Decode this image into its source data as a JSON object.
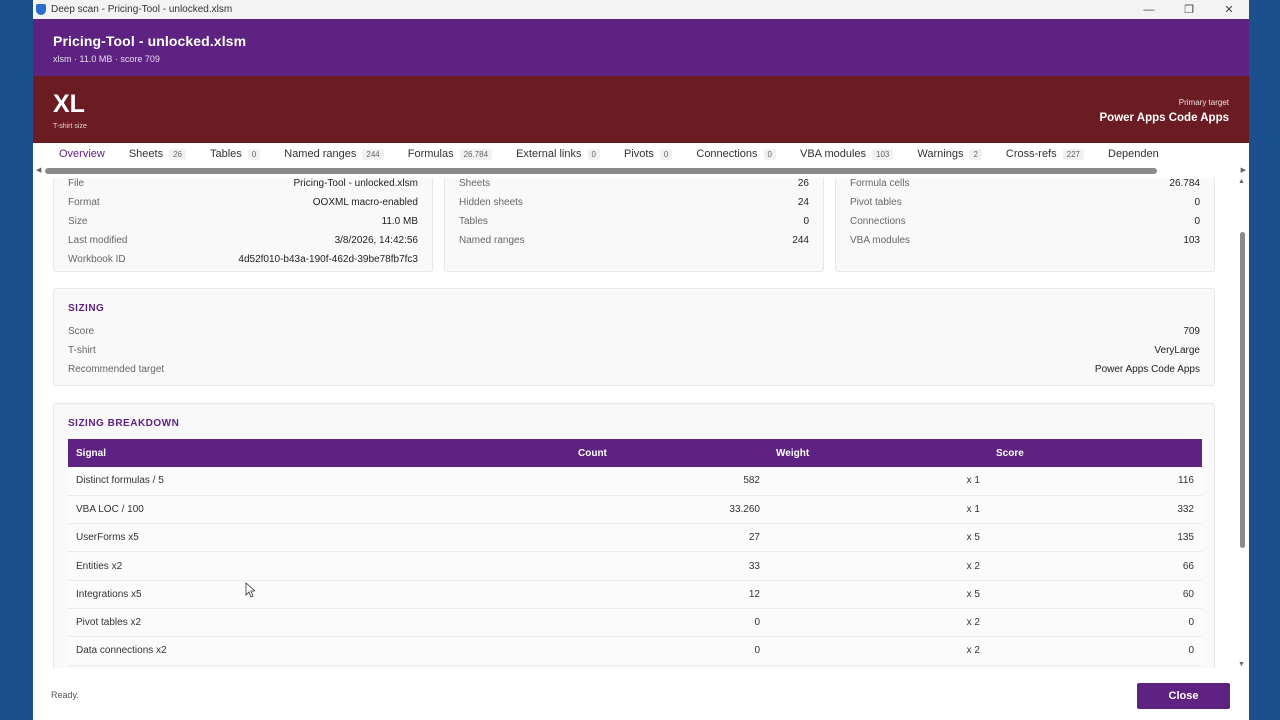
{
  "window": {
    "title": "Deep scan - Pricing-Tool - unlocked.xlsm",
    "controls": [
      "—",
      "❐",
      "✕"
    ]
  },
  "header": {
    "file_title": "Pricing-Tool - unlocked.xlsm",
    "file_meta": "xlsm · 11.0 MB · score 709",
    "size_code": "XL",
    "size_caption": "T-shirt size",
    "primary_target_label": "Primary target",
    "primary_target_value": "Power Apps Code Apps",
    "accent_purple": "#5e2282",
    "accent_red": "#6b1c22"
  },
  "tabs": [
    {
      "label": "Overview",
      "count": ""
    },
    {
      "label": "Sheets",
      "count": "26"
    },
    {
      "label": "Tables",
      "count": "0"
    },
    {
      "label": "Named ranges",
      "count": "244"
    },
    {
      "label": "Formulas",
      "count": "26.784"
    },
    {
      "label": "External links",
      "count": "0"
    },
    {
      "label": "Pivots",
      "count": "0"
    },
    {
      "label": "Connections",
      "count": "0"
    },
    {
      "label": "VBA modules",
      "count": "103"
    },
    {
      "label": "Warnings",
      "count": "2"
    },
    {
      "label": "Cross-refs",
      "count": "227"
    },
    {
      "label": "Dependen",
      "count": ""
    }
  ],
  "overview": {
    "file_card": [
      {
        "k": "File",
        "v": "Pricing-Tool - unlocked.xlsm"
      },
      {
        "k": "Format",
        "v": "OOXML macro-enabled"
      },
      {
        "k": "Size",
        "v": "11.0 MB"
      },
      {
        "k": "Last modified",
        "v": "3/8/2026, 14:42:56"
      },
      {
        "k": "Workbook ID",
        "v": "4d52f010-b43a-190f-462d-39be78fb7fc3"
      }
    ],
    "sheets_card": [
      {
        "k": "Sheets",
        "v": "26"
      },
      {
        "k": "Hidden sheets",
        "v": "24"
      },
      {
        "k": "Tables",
        "v": "0"
      },
      {
        "k": "Named ranges",
        "v": "244"
      }
    ],
    "formula_card": [
      {
        "k": "Formula cells",
        "v": "26.784"
      },
      {
        "k": "Pivot tables",
        "v": "0"
      },
      {
        "k": "Connections",
        "v": "0"
      },
      {
        "k": "VBA modules",
        "v": "103"
      }
    ]
  },
  "sizing": {
    "title": "SIZING",
    "rows": [
      {
        "k": "Score",
        "v": "709"
      },
      {
        "k": "T-shirt",
        "v": "VeryLarge"
      },
      {
        "k": "Recommended target",
        "v": "Power Apps Code Apps"
      }
    ]
  },
  "breakdown": {
    "title": "SIZING BREAKDOWN",
    "headers": {
      "signal": "Signal",
      "count": "Count",
      "weight": "Weight",
      "score": "Score"
    },
    "rows": [
      {
        "signal": "Distinct formulas / 5",
        "count": "582",
        "weight": "x 1",
        "score": "116"
      },
      {
        "signal": "VBA LOC / 100",
        "count": "33.260",
        "weight": "x 1",
        "score": "332"
      },
      {
        "signal": "UserForms x5",
        "count": "27",
        "weight": "x 5",
        "score": "135"
      },
      {
        "signal": "Entities x2",
        "count": "33",
        "weight": "x 2",
        "score": "66"
      },
      {
        "signal": "Integrations x5",
        "count": "12",
        "weight": "x 5",
        "score": "60"
      },
      {
        "signal": "Pivot tables x2",
        "count": "0",
        "weight": "x 2",
        "score": "0"
      },
      {
        "signal": "Data connections x2",
        "count": "0",
        "weight": "x 2",
        "score": "0"
      }
    ]
  },
  "footer": {
    "status": "Ready.",
    "close_label": "Close"
  }
}
